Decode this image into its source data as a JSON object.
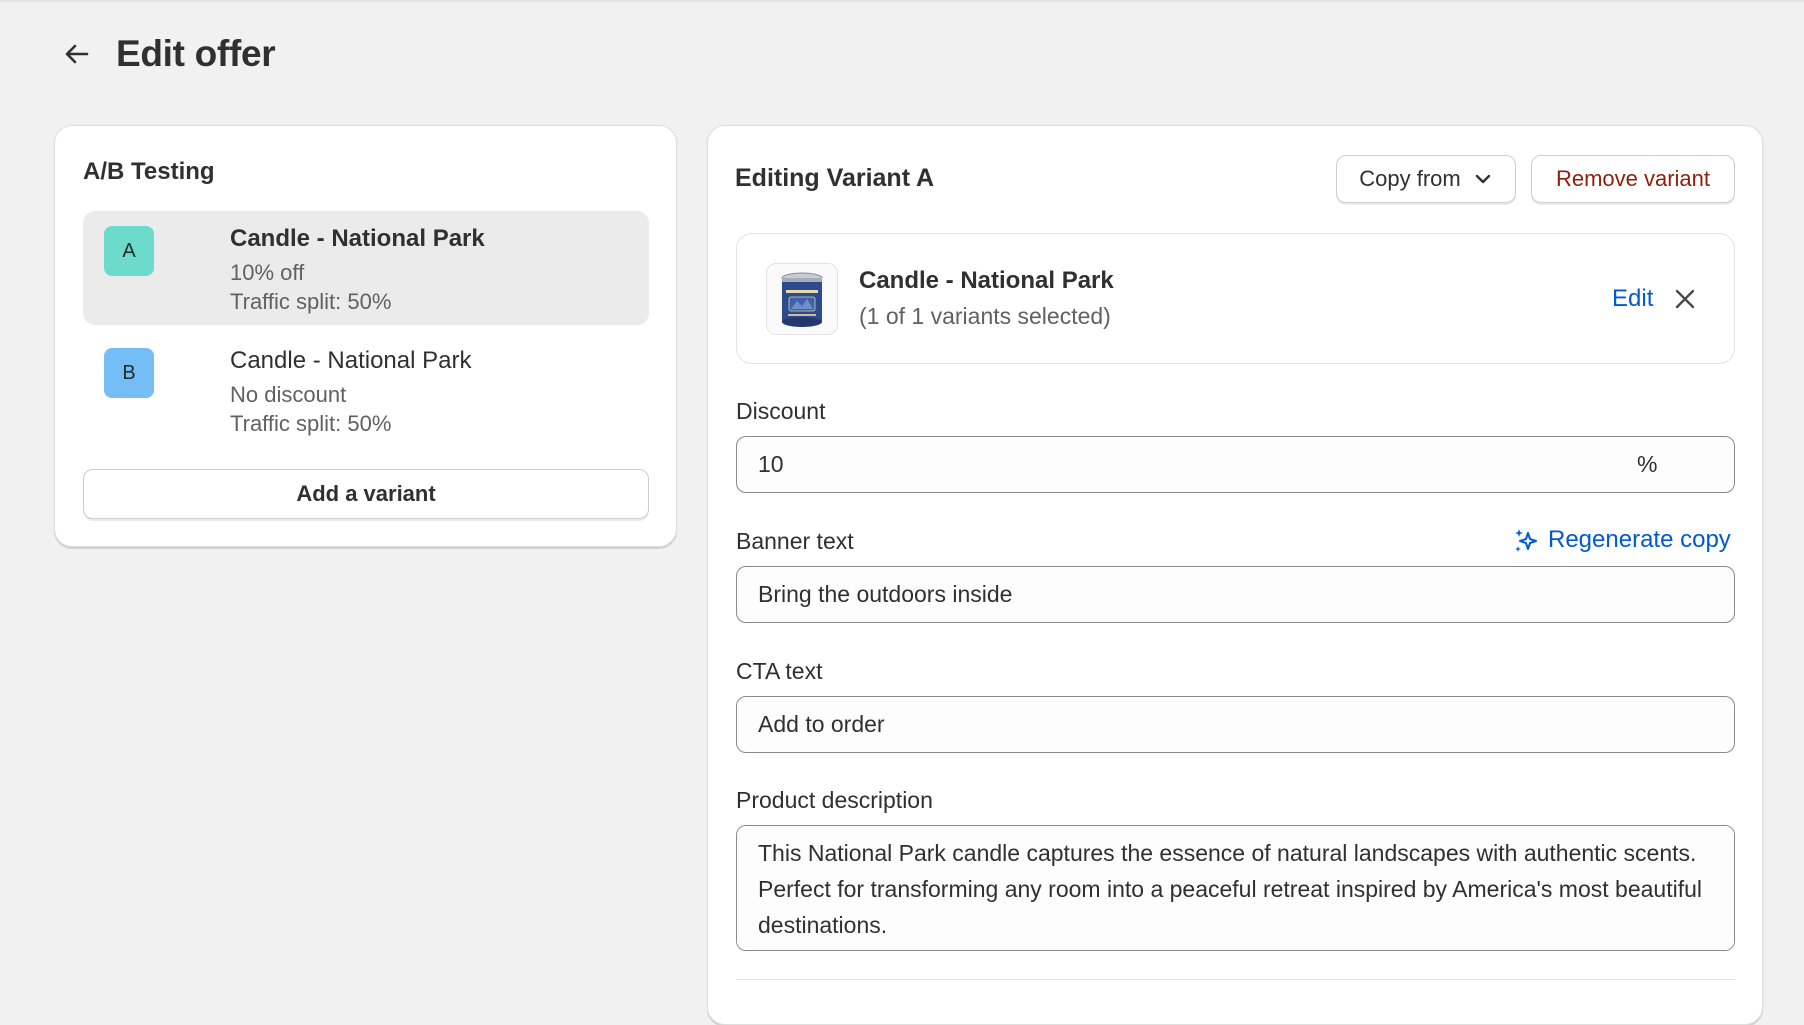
{
  "page": {
    "title": "Edit offer"
  },
  "ab_testing": {
    "title": "A/B Testing",
    "variants": [
      {
        "badge": "A",
        "name": "Candle - National Park",
        "discount": "10% off",
        "traffic": "Traffic split: 50%"
      },
      {
        "badge": "B",
        "name": "Candle - National Park",
        "discount": "No discount",
        "traffic": "Traffic split: 50%"
      }
    ],
    "add_button": "Add a variant"
  },
  "editor": {
    "title": "Editing Variant A",
    "copy_from": "Copy from",
    "remove": "Remove variant",
    "product": {
      "name": "Candle - National Park",
      "selection": "(1 of 1 variants selected)",
      "edit": "Edit"
    },
    "discount": {
      "label": "Discount",
      "value": "10",
      "suffix": "%"
    },
    "banner": {
      "label": "Banner text",
      "value": "Bring the outdoors inside",
      "regenerate": "Regenerate copy"
    },
    "cta": {
      "label": "CTA text",
      "value": "Add to order"
    },
    "description": {
      "label": "Product description",
      "value": "This National Park candle captures the essence of natural landscapes with authentic scents. Perfect for transforming any room into a peaceful retreat inspired by America's most beautiful destinations."
    }
  },
  "icons": {
    "back": "arrow-left-icon",
    "chevron": "chevron-down-icon",
    "close": "close-icon",
    "sparkle": "sparkle-icon",
    "product": "candle-tin-image"
  },
  "colors": {
    "background": "#f1f1f1",
    "badge_a": "#6ddbcb",
    "badge_b": "#74bdf6",
    "link": "#005bd3",
    "critical": "#8e1f0b",
    "selected_row": "#ebebeb"
  }
}
